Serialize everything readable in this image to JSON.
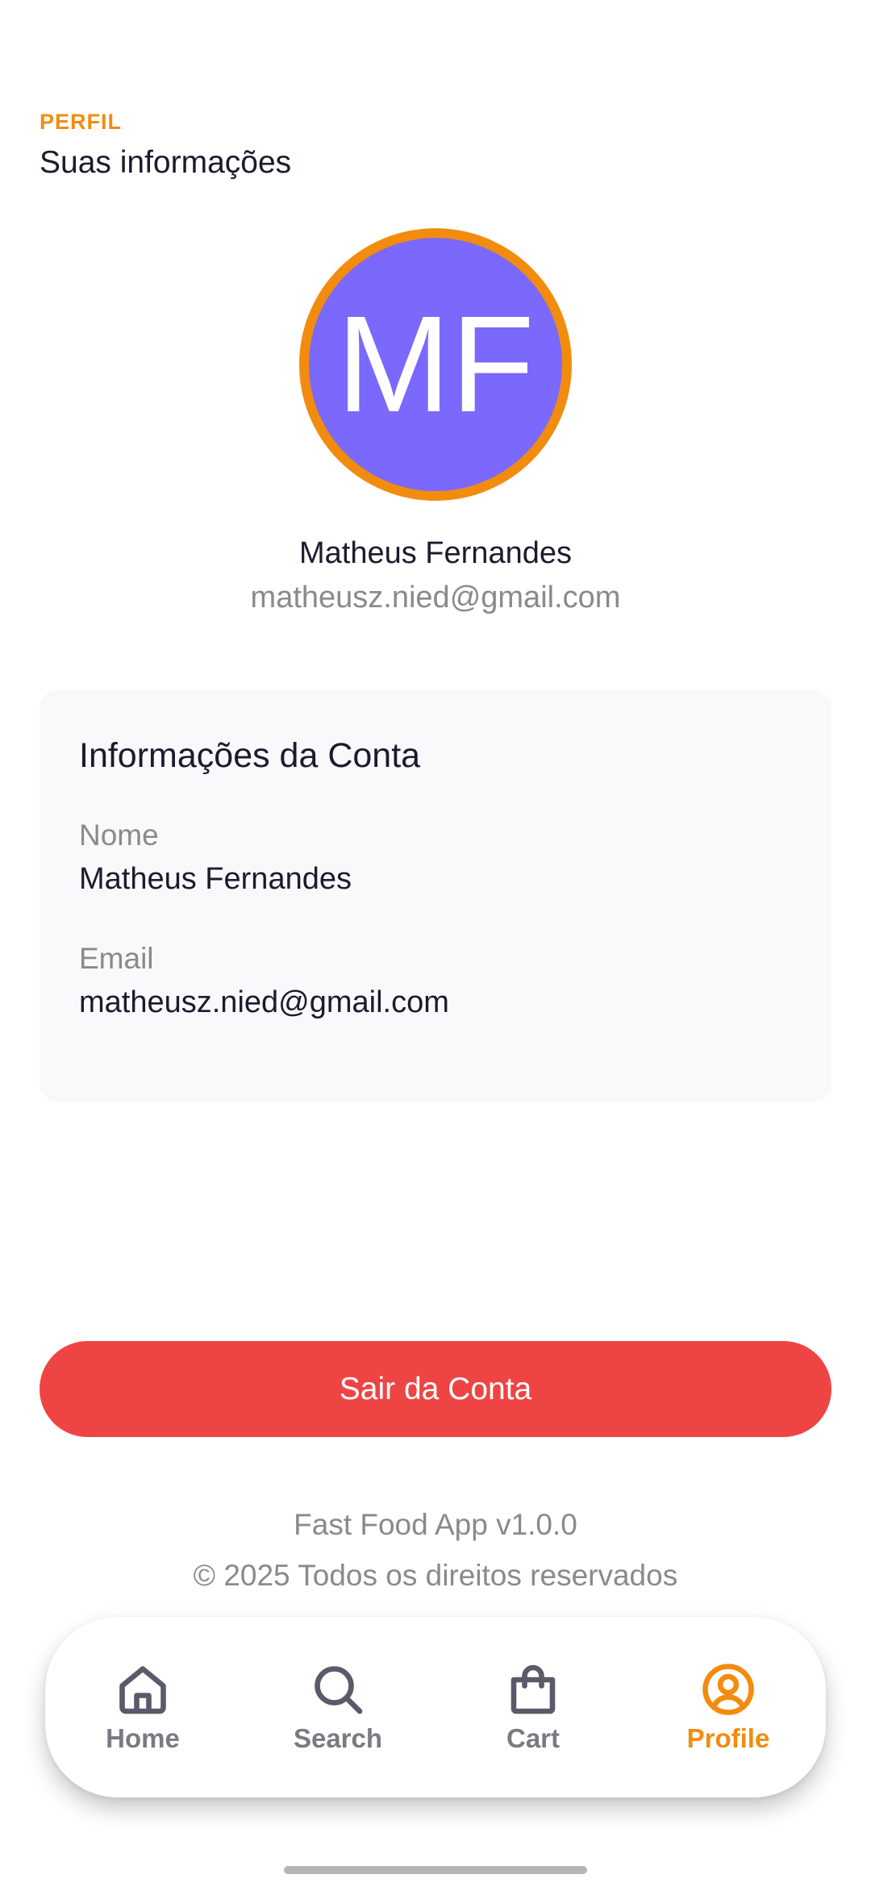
{
  "header": {
    "section_label": "PERFIL",
    "title": "Suas informações"
  },
  "profile": {
    "initials": "MF",
    "name": "Matheus Fernandes",
    "email": "matheusz.nied@gmail.com",
    "avatar_bg_color": "#7b68fc",
    "avatar_ring_color": "#f28c0f"
  },
  "account_card": {
    "title": "Informações da Conta",
    "fields": [
      {
        "label": "Nome",
        "value": "Matheus Fernandes"
      },
      {
        "label": "Email",
        "value": "matheusz.nied@gmail.com"
      }
    ]
  },
  "logout": {
    "label": "Sair da Conta",
    "color": "#ef4444"
  },
  "footer": {
    "version": "Fast Food App v1.0.0",
    "copyright": "© 2025 Todos os direitos reservados"
  },
  "nav": {
    "active_color": "#f28c0f",
    "inactive_color": "#5a5a6a",
    "items": [
      {
        "label": "Home",
        "icon": "home-icon",
        "active": false
      },
      {
        "label": "Search",
        "icon": "search-icon",
        "active": false
      },
      {
        "label": "Cart",
        "icon": "shopping-bag-icon",
        "active": false
      },
      {
        "label": "Profile",
        "icon": "user-circle-icon",
        "active": true
      }
    ]
  }
}
